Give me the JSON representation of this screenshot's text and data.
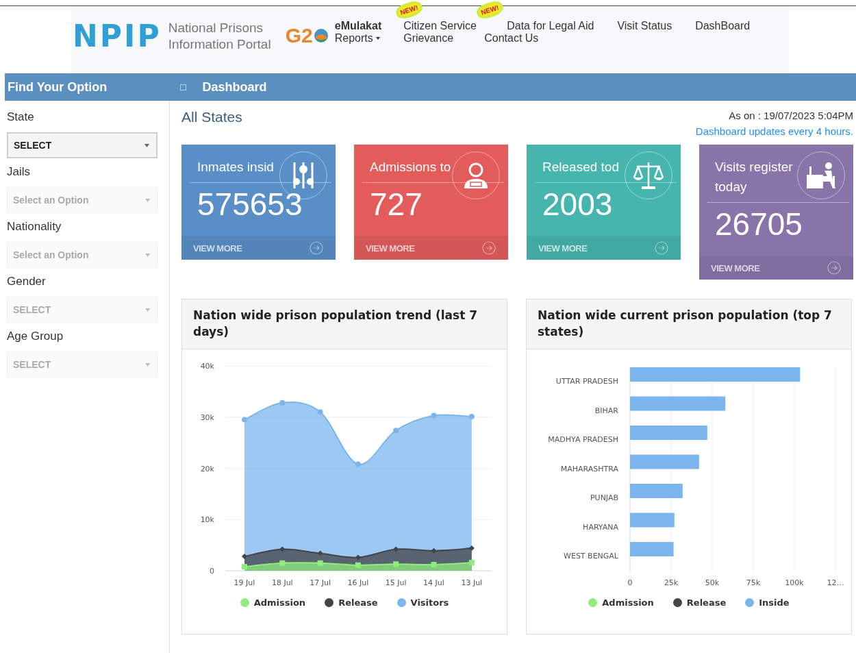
{
  "header": {
    "logo": "NPIP",
    "portal_name": "National Prisons Information Portal",
    "g20_logo": "G2",
    "nav": [
      {
        "links": [
          {
            "label": "eMulakat",
            "kind": "strong"
          },
          {
            "label": "Reports",
            "kind": "dropdown"
          }
        ]
      },
      {
        "badge": "NEW!",
        "links": [
          {
            "label": "Citizen Service Grievance",
            "kind": "plain"
          }
        ]
      },
      {
        "badge": "NEW!",
        "links": [
          {
            "label": "Data for Legal Aid",
            "kind": "plain"
          },
          {
            "label": "Contact Us",
            "kind": "plain"
          }
        ]
      },
      {
        "links": [
          {
            "label": "Visit Status",
            "kind": "plain"
          }
        ]
      },
      {
        "links": [
          {
            "label": "DashBoard",
            "kind": "plain"
          }
        ]
      }
    ]
  },
  "title_bar": {
    "sidebar_title": "Find Your Option",
    "toggle": "□",
    "page_title": "Dashboard"
  },
  "sidebar": {
    "filters": [
      {
        "label": "State",
        "value": "SELECT",
        "disabled": false
      },
      {
        "label": "Jails",
        "value": "Select an Option",
        "disabled": true
      },
      {
        "label": "Nationality",
        "value": "Select an Option",
        "disabled": true
      },
      {
        "label": "Gender",
        "value": "SELECT",
        "disabled": true
      },
      {
        "label": "Age Group",
        "value": "SELECT",
        "disabled": true
      }
    ]
  },
  "main": {
    "heading": "All States",
    "as_on": "As on : 19/07/2023 5:04PM",
    "update_note": "Dashboard updates every 4 hours.",
    "cards": [
      {
        "kind": "inmates",
        "title": "Inmates insid",
        "value": "575653",
        "link": "VIEW MORE",
        "color": "#5a8ec6"
      },
      {
        "kind": "admissions",
        "title": "Admissions to",
        "value": "727",
        "link": "VIEW MORE",
        "color": "#e35c5c"
      },
      {
        "kind": "released",
        "title": "Released tod",
        "value": "2003",
        "link": "VIEW MORE",
        "color": "#45b5ad"
      },
      {
        "kind": "visits",
        "title": "Visits register\ntoday",
        "value": "26705",
        "link": "VIEW MORE",
        "color": "#8874a9"
      }
    ],
    "charts": [
      {
        "title": "Nation wide prison population trend (last 7 days)",
        "chart_data": {
          "type": "area",
          "grid": true,
          "legend": "bottom",
          "categories": [
            "19 Jul",
            "18 Jul",
            "17 Jul",
            "16 Jul",
            "15 Jul",
            "14 Jul",
            "13 Jul"
          ],
          "ylim": [
            0,
            40000
          ],
          "yticks": [
            {
              "value": 0,
              "label": "0"
            },
            {
              "value": 10000,
              "label": "10k"
            },
            {
              "value": 20000,
              "label": "20k"
            },
            {
              "value": 30000,
              "label": "30k"
            },
            {
              "value": 40000,
              "label": "40k"
            }
          ],
          "series": [
            {
              "name": "Admission",
              "color": "#90ed7d",
              "values": [
                800,
                1500,
                1500,
                1100,
                1300,
                1200,
                1600
              ]
            },
            {
              "name": "Release",
              "color": "#434348",
              "values": [
                2800,
                4200,
                3400,
                2600,
                4200,
                3900,
                4400
              ]
            },
            {
              "name": "Visitors",
              "color": "#7cb5ec",
              "values": [
                29500,
                32800,
                31000,
                20800,
                27400,
                30300,
                30100
              ]
            }
          ]
        }
      },
      {
        "title": "Nation wide current prison population (top 7 states)",
        "chart_data": {
          "type": "bar",
          "orientation": "horizontal",
          "grid": true,
          "legend": "bottom",
          "categories": [
            "UTTAR PRADESH",
            "BIHAR",
            "MADHYA PRADESH",
            "MAHARASHTRA",
            "PUNJAB",
            "HARYANA",
            "WEST BENGAL"
          ],
          "xlim": [
            0,
            125000
          ],
          "xticks": [
            {
              "value": 0,
              "label": "0"
            },
            {
              "value": 25000,
              "label": "25k"
            },
            {
              "value": 50000,
              "label": "50k"
            },
            {
              "value": 75000,
              "label": "75k"
            },
            {
              "value": 100000,
              "label": "100k"
            },
            {
              "value": 125000,
              "label": "12…"
            }
          ],
          "series": [
            {
              "name": "Admission",
              "color": "#90ed7d",
              "values": [
                null,
                null,
                null,
                null,
                null,
                null,
                null
              ]
            },
            {
              "name": "Release",
              "color": "#434348",
              "values": [
                null,
                null,
                null,
                null,
                null,
                null,
                null
              ]
            },
            {
              "name": "Inside",
              "color": "#7cb5ec",
              "values": [
                103500,
                58000,
                47000,
                42000,
                32000,
                27000,
                26500
              ]
            }
          ]
        }
      }
    ]
  }
}
